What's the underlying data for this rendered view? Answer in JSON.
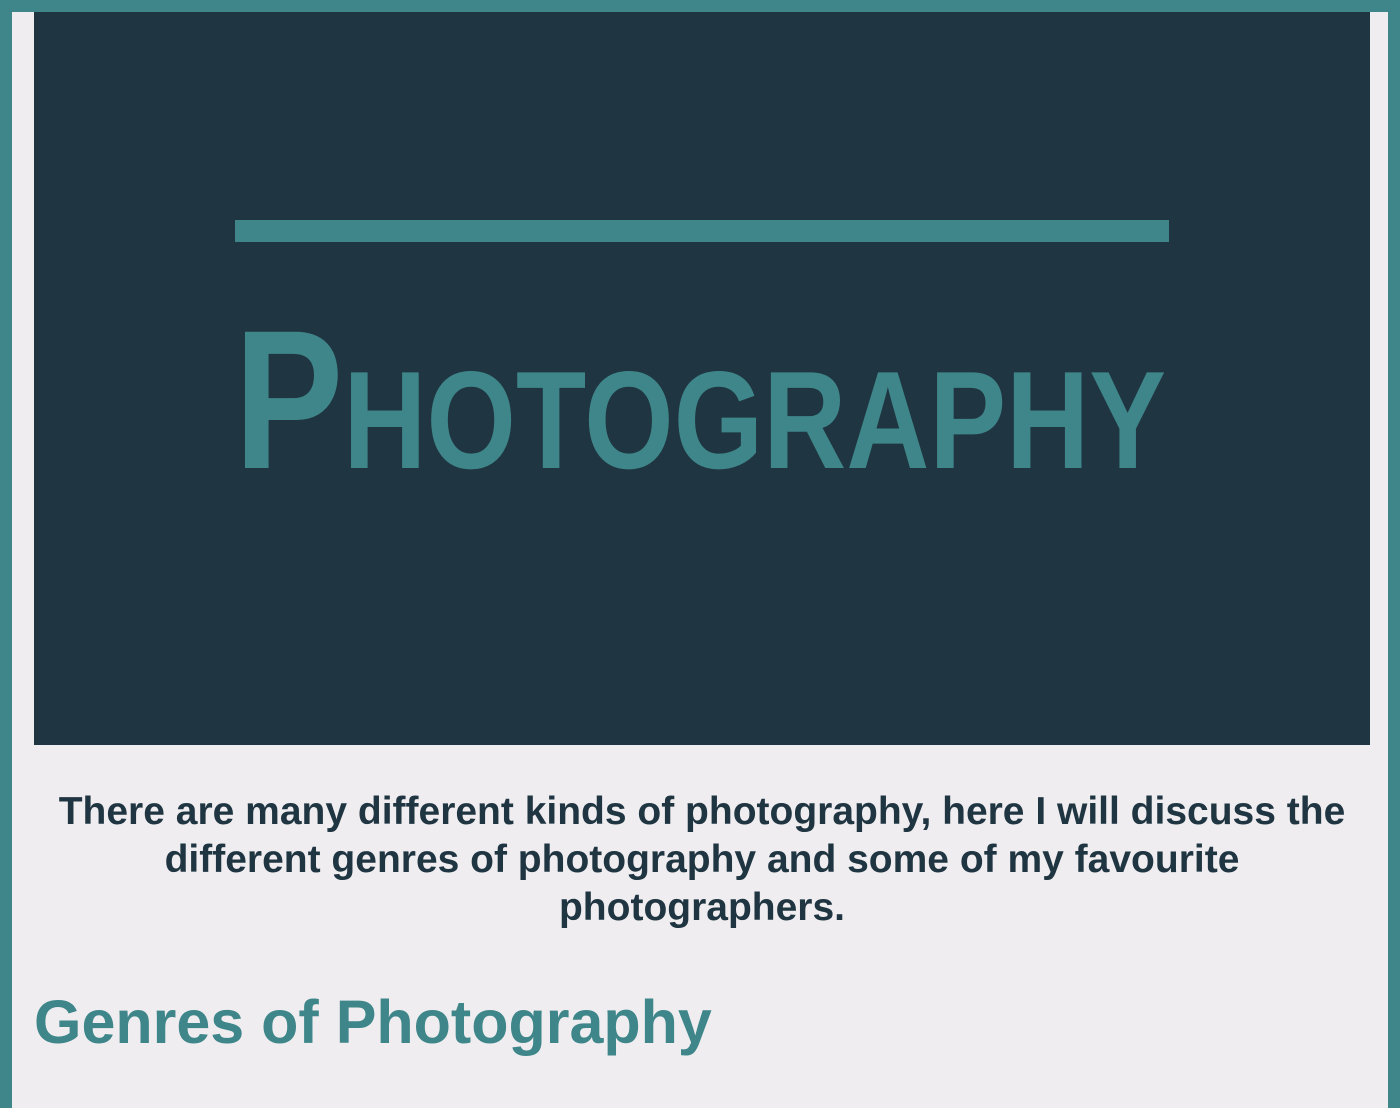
{
  "hero": {
    "title": "Photography",
    "colors": {
      "background": "#1f3541",
      "accent": "#3e8689"
    }
  },
  "intro": {
    "text": "There are many different kinds of photography, here I will discuss the different genres of photography and some of my favourite photographers."
  },
  "sections": [
    {
      "heading": "Genres of Photography"
    }
  ],
  "colors": {
    "page_background": "#efedf0",
    "text_dark": "#1f3541",
    "accent": "#3e8689"
  }
}
